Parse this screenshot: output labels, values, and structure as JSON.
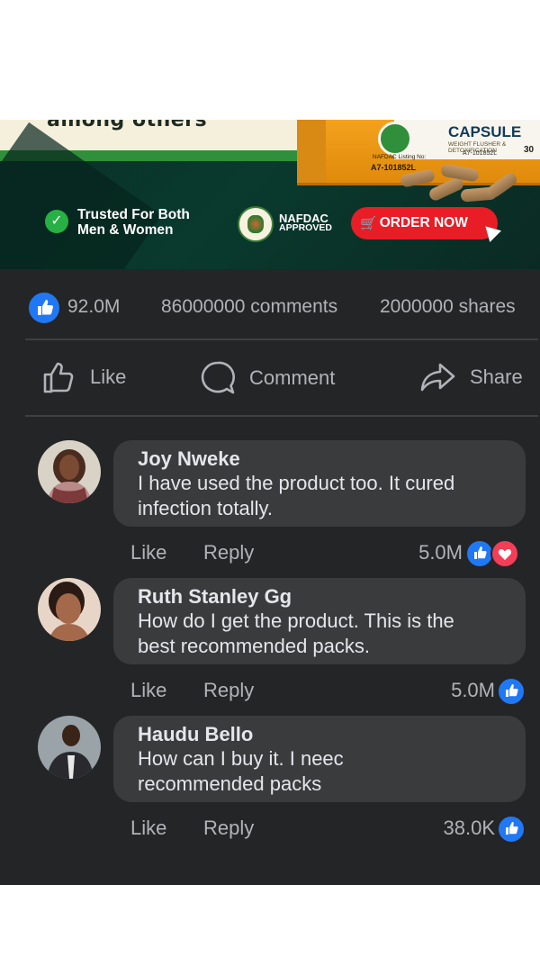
{
  "ad": {
    "top_text": "among others",
    "product": {
      "name": "CAPSULE",
      "subtitle": "WEIGHT FLUSHER & DETOXIFICATION",
      "listing_label": "NAFDAC Listing No:",
      "listing_no": "A7-101852L",
      "count": "30"
    },
    "trusted_line1": "Trusted For Both",
    "trusted_line2": "Men & Women",
    "nafdac_line1": "NAFDAC",
    "nafdac_line2": "APPROVED",
    "order_button": "ORDER NOW"
  },
  "stats": {
    "likes": "92.0M",
    "comments": "86000000 comments",
    "shares": "2000000 shares"
  },
  "actions": {
    "like": "Like",
    "comment": "Comment",
    "share": "Share"
  },
  "comments": [
    {
      "name": "Joy Nweke",
      "line1": "I have used the product too. It cured",
      "line2": "infection totally.",
      "like": "Like",
      "reply": "Reply",
      "reactions": "5.0M",
      "reaction_icons": [
        "like",
        "love"
      ]
    },
    {
      "name": "Ruth Stanley Gg",
      "line1": "How do I get the product. This is the",
      "line2": "best recommended packs.",
      "like": "Like",
      "reply": "Reply",
      "reactions": "5.0M",
      "reaction_icons": [
        "like"
      ]
    },
    {
      "name": "Haudu Bello",
      "line1": "How can I buy it. I neec",
      "line2": "recommended packs",
      "like": "Like",
      "reply": "Reply",
      "reactions": "38.0K",
      "reaction_icons": [
        "like"
      ]
    }
  ],
  "colors": {
    "background": "#242526",
    "bubble": "#3a3b3c",
    "like_blue": "#2078f4",
    "love_red": "#f33e58",
    "order_red": "#e81d25"
  }
}
